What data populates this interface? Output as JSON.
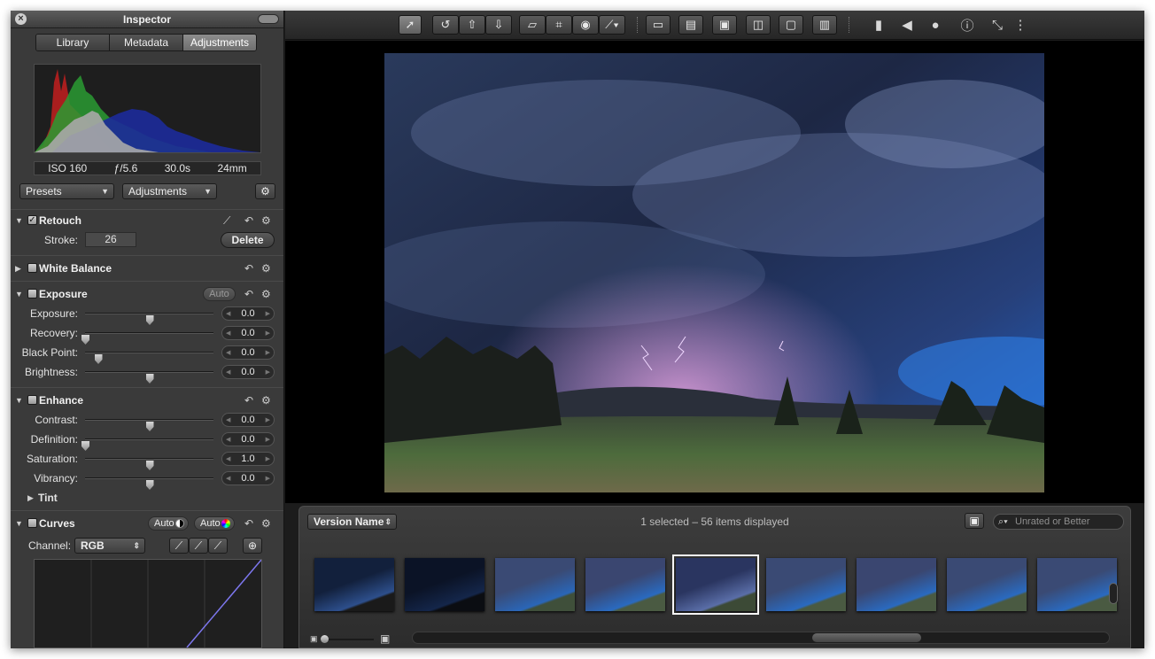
{
  "inspector": {
    "title": "Inspector",
    "tabs": [
      {
        "label": "Library",
        "active": false
      },
      {
        "label": "Metadata",
        "active": false
      },
      {
        "label": "Adjustments",
        "active": true
      }
    ],
    "exif": {
      "iso": "ISO 160",
      "aperture": "ƒ/5.6",
      "shutter": "30.0s",
      "focal": "24mm"
    },
    "presets_label": "Presets",
    "adjustments_label": "Adjustments",
    "retouch": {
      "label": "Retouch",
      "checked": true,
      "stroke_label": "Stroke:",
      "stroke_value": "26",
      "delete_label": "Delete"
    },
    "white_balance": {
      "label": "White Balance"
    },
    "exposure": {
      "label": "Exposure",
      "auto_label": "Auto",
      "rows": [
        {
          "label": "Exposure:",
          "value": "0.0",
          "level": 0.5
        },
        {
          "label": "Recovery:",
          "value": "0.0",
          "level": 0.0
        },
        {
          "label": "Black Point:",
          "value": "0.0",
          "level": 0.1
        },
        {
          "label": "Brightness:",
          "value": "0.0",
          "level": 0.5
        }
      ]
    },
    "enhance": {
      "label": "Enhance",
      "rows": [
        {
          "label": "Contrast:",
          "value": "0.0",
          "level": 0.5
        },
        {
          "label": "Definition:",
          "value": "0.0",
          "level": 0.0
        },
        {
          "label": "Saturation:",
          "value": "1.0",
          "level": 0.5
        },
        {
          "label": "Vibrancy:",
          "value": "0.0",
          "level": 0.5
        }
      ],
      "tint_label": "Tint"
    },
    "curves": {
      "label": "Curves",
      "auto1": "Auto",
      "auto2": "Auto",
      "channel_label": "Channel:",
      "channel_value": "RGB"
    }
  },
  "toolbar": {
    "icons": [
      "pointer-icon",
      "rotate-left-icon",
      "lift-icon",
      "stamp-icon",
      "straighten-icon",
      "crop-icon",
      "red-eye-icon",
      "brush-icon",
      "slideshow-icon",
      "filmstrip-icon",
      "view-mode-icon",
      "compare-icon",
      "stage-icon",
      "browser-icon",
      "loupe-icon",
      "metadata-tag-icon",
      "color-palette-icon",
      "info-icon",
      "exit-fullscreen-icon",
      "toggle-icon"
    ]
  },
  "browser": {
    "sort_label": "Version Name",
    "status_text": "1 selected – 56 items displayed",
    "search_placeholder": "Unrated or Better",
    "thumbnail_count": 9,
    "selected_index": 4
  },
  "colors": {
    "panel_bg": "#3a3a3a",
    "viewer_bg": "#000000",
    "selection_outline": "#f5f5f5",
    "curve_line": "#7d77ee"
  }
}
